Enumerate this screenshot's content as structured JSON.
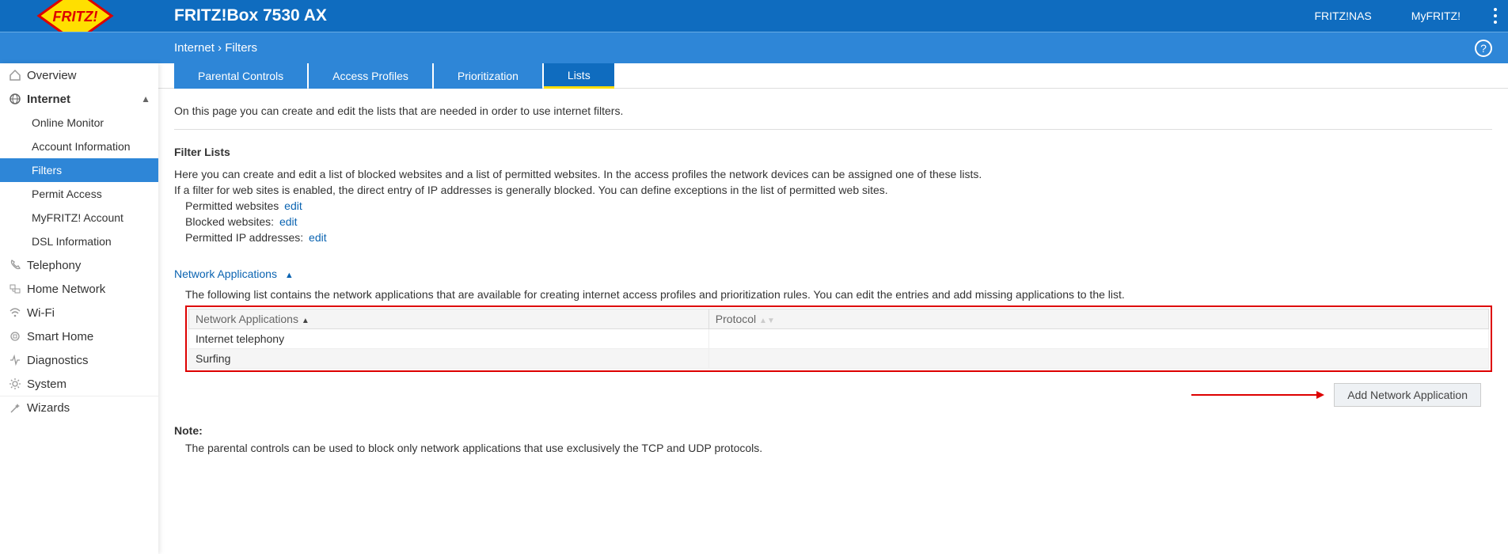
{
  "header": {
    "title": "FRITZ!Box 7530 AX",
    "links": [
      "FRITZ!NAS",
      "MyFRITZ!"
    ]
  },
  "breadcrumb": {
    "parent": "Internet",
    "current": "Filters"
  },
  "tabs": {
    "items": [
      "Parental Controls",
      "Access Profiles",
      "Prioritization",
      "Lists"
    ],
    "activeIndex": 3
  },
  "sidebar": {
    "items": [
      {
        "icon": "home",
        "label": "Overview",
        "sub": []
      },
      {
        "icon": "globe",
        "label": "Internet",
        "expanded": true,
        "sub": [
          "Online Monitor",
          "Account Information",
          "Filters",
          "Permit Access",
          "MyFRITZ! Account",
          "DSL Information"
        ],
        "activeSub": 2
      },
      {
        "icon": "phone",
        "label": "Telephony",
        "sub": []
      },
      {
        "icon": "network",
        "label": "Home Network",
        "sub": []
      },
      {
        "icon": "wifi",
        "label": "Wi-Fi",
        "sub": []
      },
      {
        "icon": "smarthome",
        "label": "Smart Home",
        "sub": []
      },
      {
        "icon": "diag",
        "label": "Diagnostics",
        "sub": []
      },
      {
        "icon": "gear",
        "label": "System",
        "sub": []
      },
      {
        "icon": "wand",
        "label": "Wizards",
        "sub": []
      }
    ]
  },
  "content": {
    "intro": "On this page you can create and edit the lists that are needed in order to use internet filters.",
    "filterLists": {
      "title": "Filter Lists",
      "desc1": "Here you can create and edit a list of blocked websites and a list of permitted websites. In the access profiles the network devices can be assigned one of these lists.",
      "desc2": "If a filter for web sites is enabled, the direct entry of IP addresses is generally blocked. You can define exceptions in the list of permitted web sites.",
      "lines": [
        {
          "label": "Permitted websites",
          "link": "edit"
        },
        {
          "label": "Blocked websites:",
          "link": "edit"
        },
        {
          "label": "Permitted IP addresses:",
          "link": "edit"
        }
      ]
    },
    "networkApps": {
      "title": "Network Applications",
      "desc": "The following list contains the network applications that are available for creating internet access profiles and prioritization rules. You can edit the entries and add missing applications to the list.",
      "columns": [
        "Network Applications",
        "Protocol"
      ],
      "rows": [
        {
          "app": "Internet telephony",
          "proto": ""
        },
        {
          "app": "Surfing",
          "proto": ""
        }
      ],
      "addBtn": "Add Network Application"
    },
    "note": {
      "title": "Note:",
      "body": "The parental controls can be used to block only network applications that use exclusively the TCP and UDP protocols."
    }
  }
}
